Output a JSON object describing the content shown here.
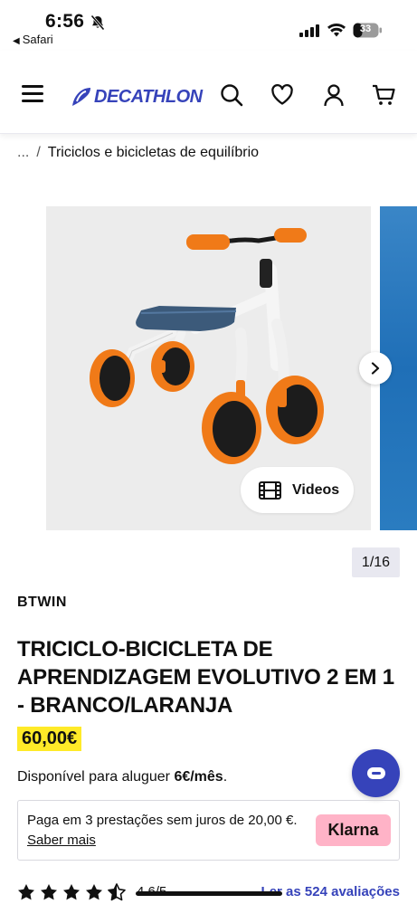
{
  "status_bar": {
    "time": "6:56",
    "back_app": "Safari",
    "battery": "33"
  },
  "header": {
    "logo_text": "DECATHLON",
    "brand_color": "#3643ba"
  },
  "breadcrumb": {
    "ellipsis": "...",
    "separator": "/",
    "current": "Triciclos e bicicletas de equilíbrio"
  },
  "gallery": {
    "videos_label": "Videos",
    "counter": "1/16"
  },
  "product": {
    "brand": "BTWIN",
    "title": "TRICICLO-BICICLETA DE APRENDIZAGEM EVOLUTIVO 2 EM 1 - BRANCO/LARANJA",
    "price": "60,00€",
    "rental_prefix": "Disponível para aluguer ",
    "rental_price": "6€/mês",
    "rental_suffix": "."
  },
  "klarna": {
    "text": "Paga em 3 prestações sem juros de 20,00 €.",
    "link": "Saber mais",
    "logo": "Klarna"
  },
  "ratings": {
    "stars": 4.5,
    "value": "4.6/5",
    "reviews_link": "Ler as 524 avaliações"
  }
}
